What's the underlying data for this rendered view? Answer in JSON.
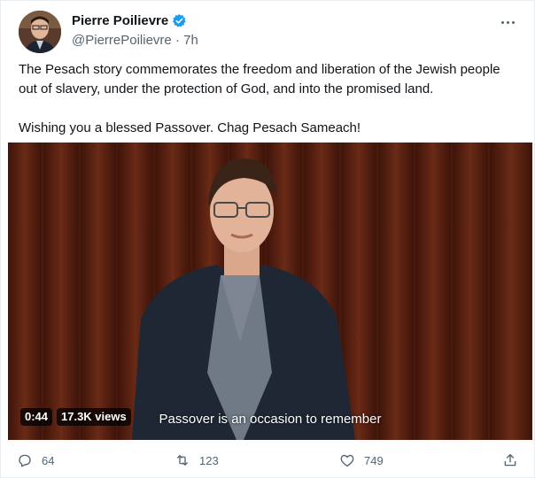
{
  "author": {
    "name": "Pierre Poilievre",
    "handle": "@PierrePoilievre",
    "separator": "·",
    "time": "7h",
    "verified": true
  },
  "tweet": {
    "paragraph1": "The Pesach story commemorates the freedom and liberation of the Jewish people out of slavery, under the protection of God, and into the promised land.",
    "paragraph2": "Wishing you a blessed Passover. Chag Pesach Sameach!"
  },
  "video": {
    "duration": "0:44",
    "views": "17.3K views",
    "caption": "Passover is an occasion to remember"
  },
  "actions": {
    "reply_count": "64",
    "retweet_count": "123",
    "like_count": "749"
  },
  "icons": {
    "verified": "verified-badge-icon",
    "more": "more-dots-icon",
    "reply": "reply-icon",
    "retweet": "retweet-icon",
    "like": "heart-icon",
    "share": "share-icon"
  },
  "colors": {
    "accent": "#1d9bf0",
    "text": "#0f1419",
    "muted": "#536471"
  }
}
